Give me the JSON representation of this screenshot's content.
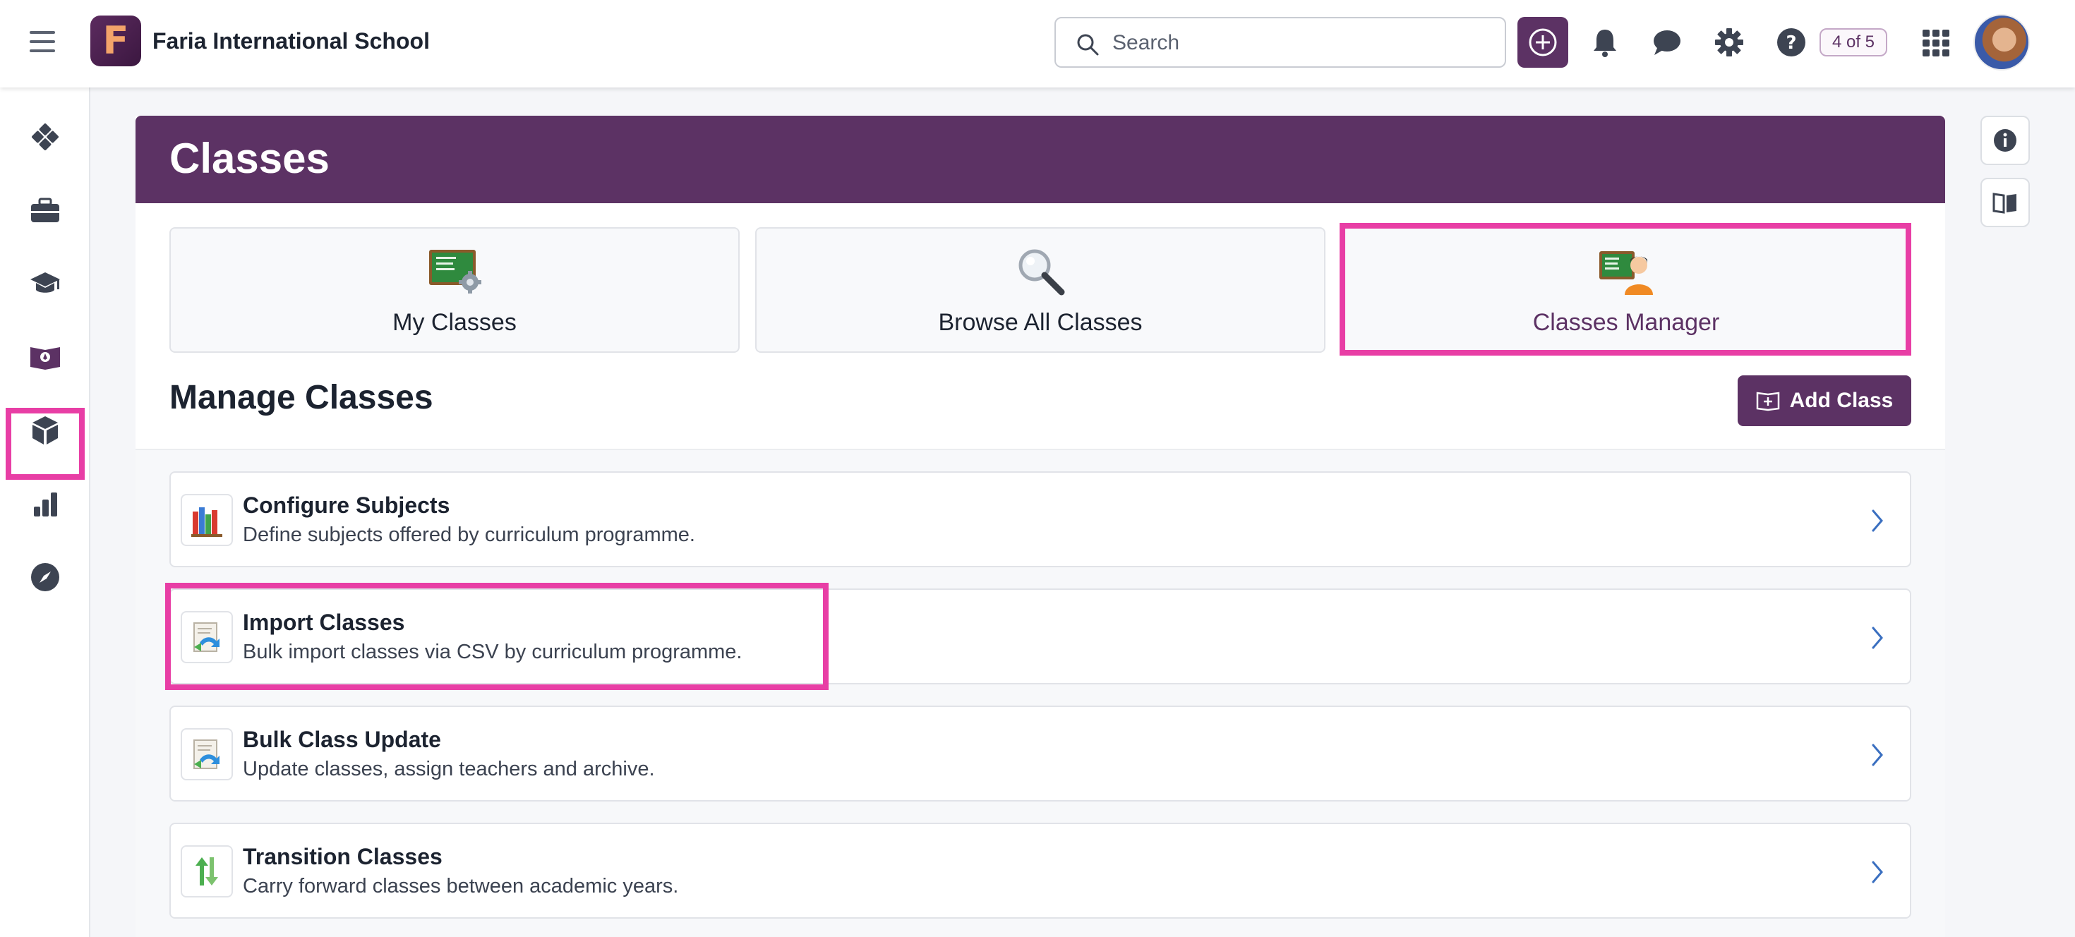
{
  "topbar": {
    "school_name": "Faria International School",
    "logo_letter": "F",
    "search_placeholder": "Search",
    "help_counter": "4 of 5",
    "icons": [
      "menu-icon",
      "plus-circle-icon",
      "bell-icon",
      "chat-icon",
      "gear-icon",
      "help-icon",
      "apps-grid-icon",
      "avatar"
    ]
  },
  "sidebar": {
    "items": [
      {
        "name": "dashboard",
        "icon": "diamond-grid-icon"
      },
      {
        "name": "portfolio",
        "icon": "briefcase-icon"
      },
      {
        "name": "students",
        "icon": "graduation-cap-icon"
      },
      {
        "name": "classes",
        "icon": "classroom-board-icon",
        "active": true
      },
      {
        "name": "resources",
        "icon": "cube-icon"
      },
      {
        "name": "reports",
        "icon": "bar-chart-icon"
      },
      {
        "name": "explore",
        "icon": "compass-icon"
      }
    ]
  },
  "right_bar": {
    "icons": [
      "info-icon",
      "book-icon"
    ]
  },
  "page": {
    "title": "Classes",
    "tiles": [
      {
        "label": "My Classes",
        "icon": "chalkboard-gear-icon"
      },
      {
        "label": "Browse All Classes",
        "icon": "magnifier-icon"
      },
      {
        "label": "Classes Manager",
        "icon": "chalkboard-person-icon",
        "highlighted": true
      }
    ],
    "section_title": "Manage Classes",
    "add_class_label": "Add Class",
    "rows": [
      {
        "title": "Configure Subjects",
        "desc": "Define subjects offered by curriculum programme.",
        "icon": "books-icon"
      },
      {
        "title": "Import Classes",
        "desc": "Bulk import classes via CSV by curriculum programme.",
        "icon": "import-document-icon",
        "highlighted": true
      },
      {
        "title": "Bulk Class Update",
        "desc": "Update classes, assign teachers and archive.",
        "icon": "update-document-icon"
      },
      {
        "title": "Transition Classes",
        "desc": "Carry forward classes between academic years.",
        "icon": "transition-arrows-icon"
      }
    ]
  },
  "colors": {
    "brand_purple": "#5c3264",
    "highlight_pink": "#e83ea5",
    "logo_orange": "#f3a36a"
  }
}
